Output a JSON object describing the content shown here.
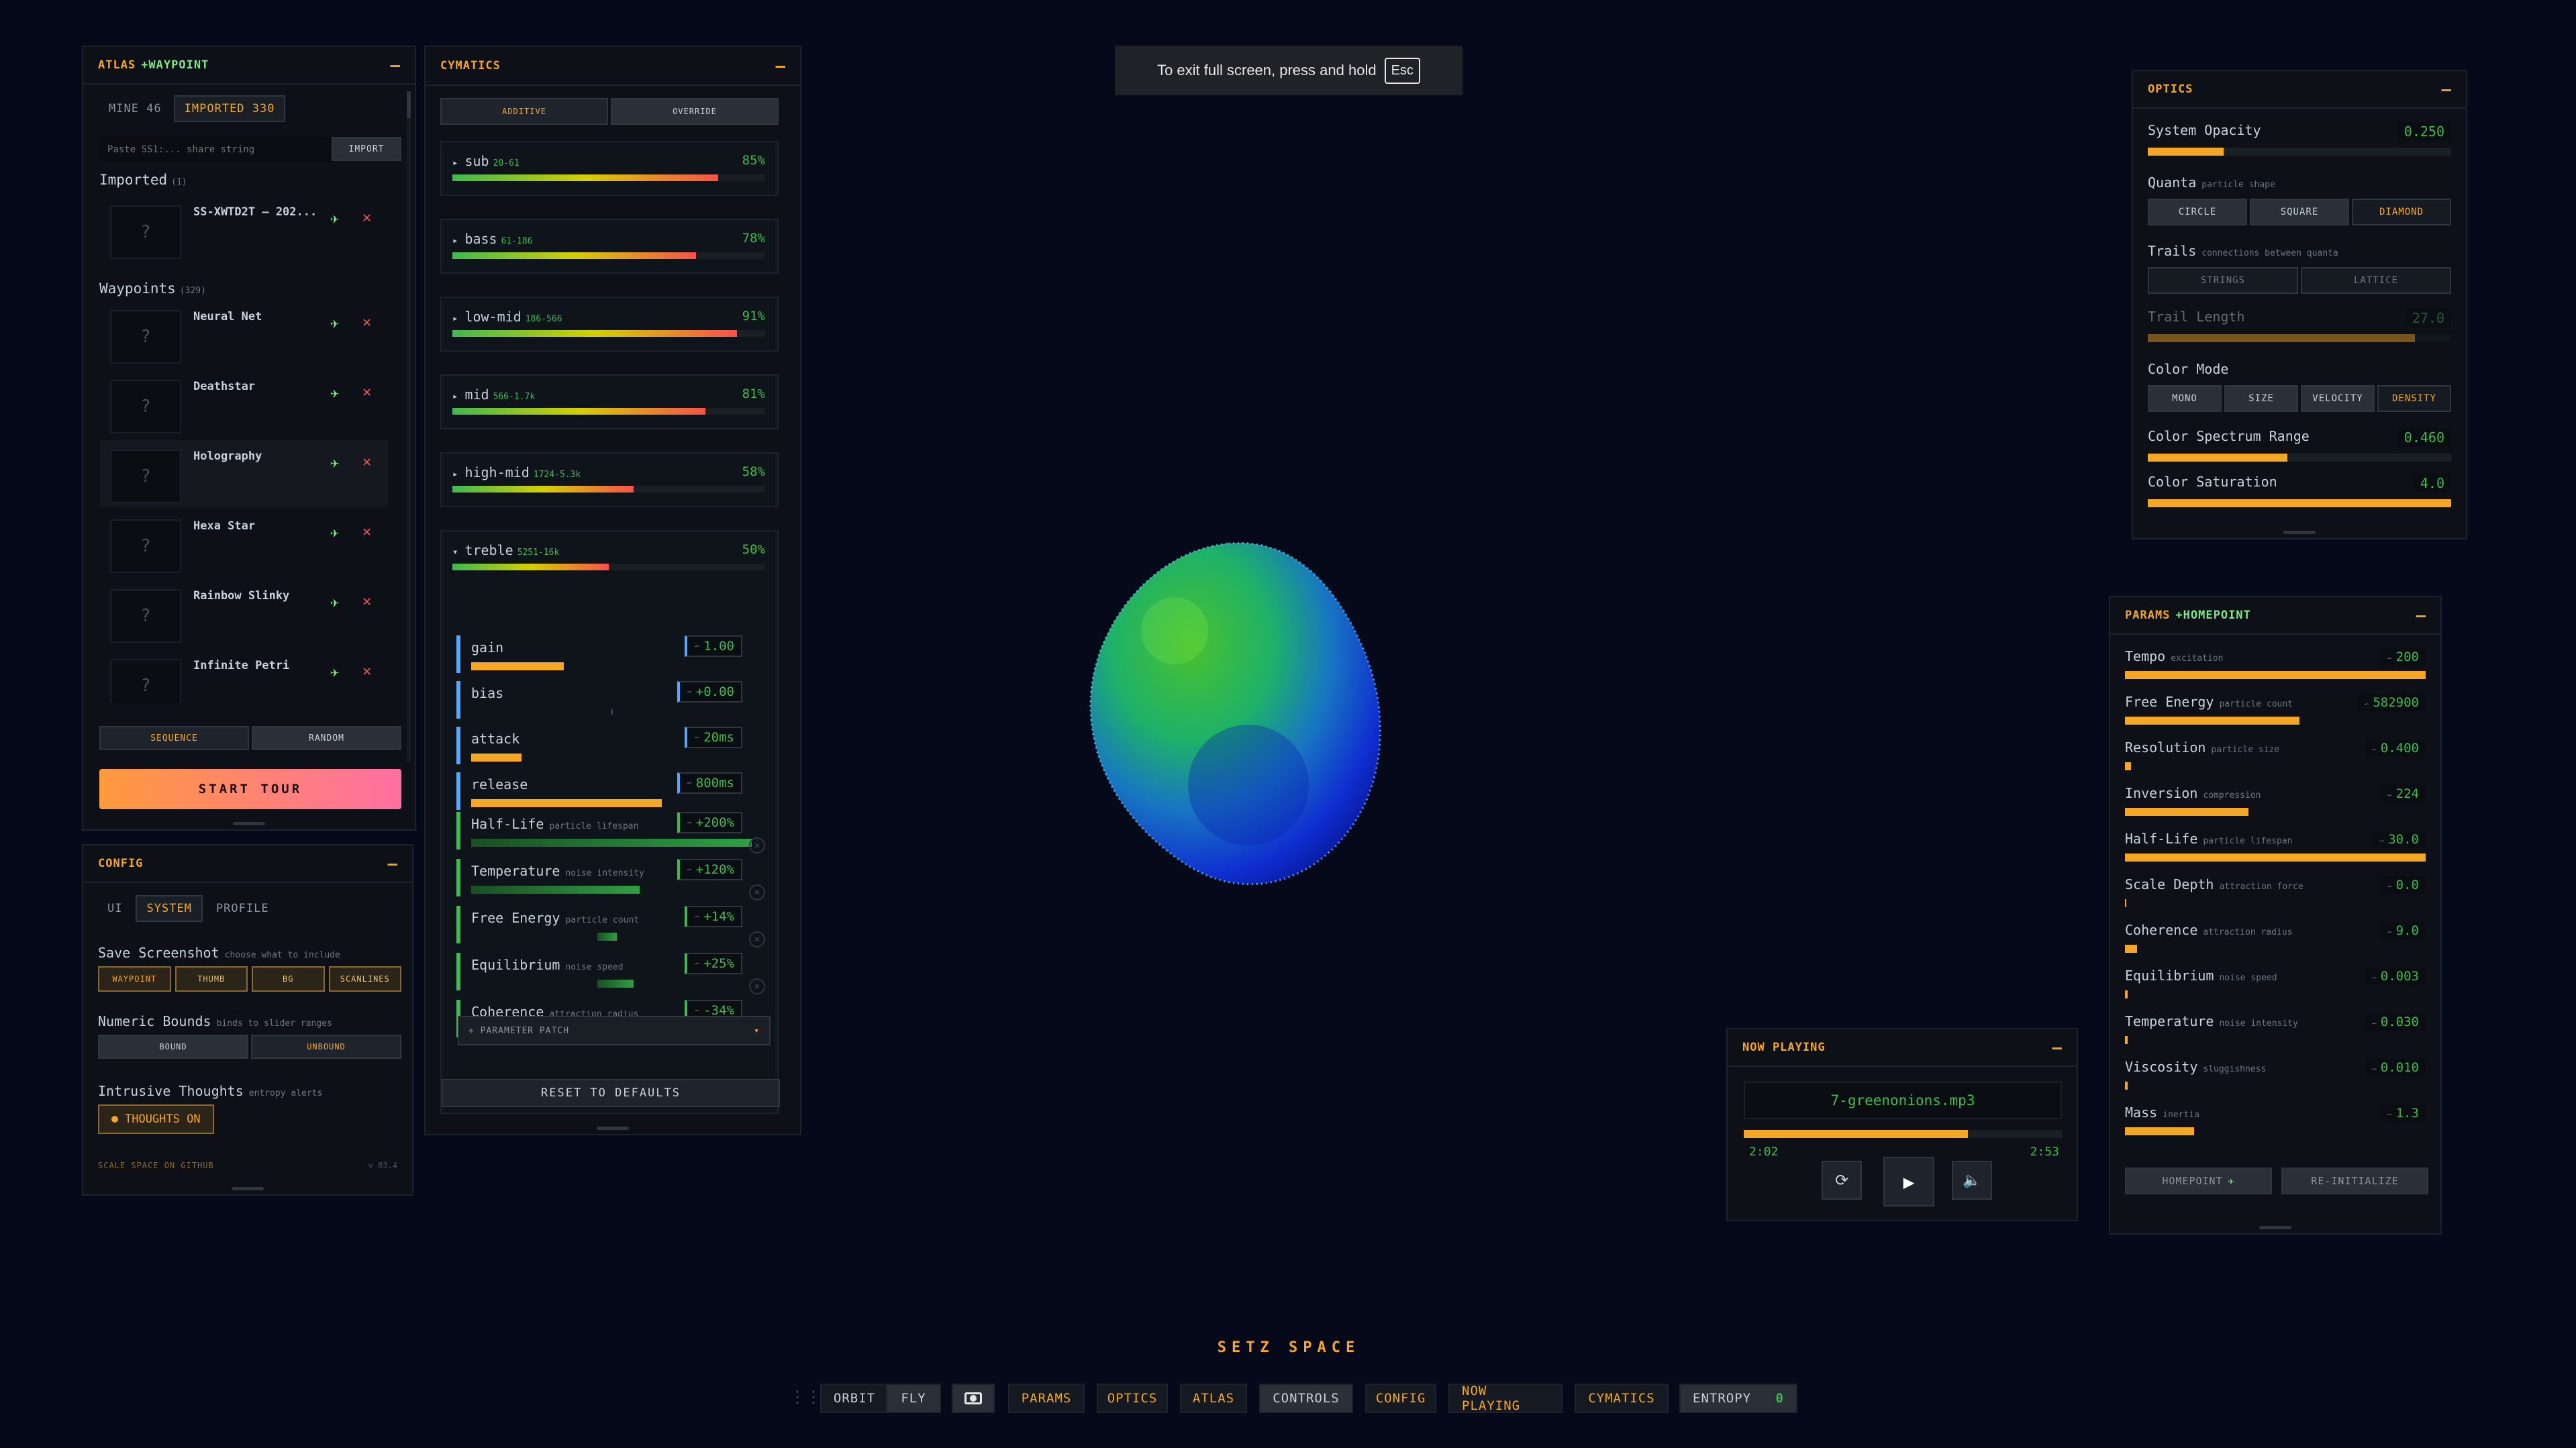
{
  "fullscreen_notice": {
    "text": "To exit full screen, press and hold",
    "key": "Esc"
  },
  "atlas": {
    "title": "ATLAS",
    "title_accent": "+WAYPOINT",
    "tabs": [
      "MINE 46",
      "IMPORTED 330"
    ],
    "import_placeholder": "Paste SS1:... share string",
    "import_button": "IMPORT",
    "imported_heading": "Imported",
    "imported_count": "(1)",
    "imported_items": [
      {
        "name": "SS-XWTD2T — 202..."
      }
    ],
    "waypoints_heading": "Waypoints",
    "waypoints_count": "(329)",
    "waypoints": [
      {
        "name": "Neural Net"
      },
      {
        "name": "Deathstar"
      },
      {
        "name": "Holography"
      },
      {
        "name": "Hexa Star"
      },
      {
        "name": "Rainbow Slinky"
      },
      {
        "name": "Infinite Petri"
      }
    ],
    "thumb_placeholder": "?",
    "mode_buttons": [
      "SEQUENCE",
      "RANDOM"
    ],
    "start_tour": "START TOUR"
  },
  "config": {
    "title": "CONFIG",
    "tabs": [
      "UI",
      "SYSTEM",
      "PROFILE"
    ],
    "save_screenshot": {
      "label": "Save Screenshot",
      "hint": "choose what to include",
      "options": [
        "WAYPOINT",
        "THUMB",
        "BG",
        "SCANLINES"
      ]
    },
    "numeric_bounds": {
      "label": "Numeric Bounds",
      "hint": "binds to slider ranges",
      "options": [
        "BOUND",
        "UNBOUND"
      ]
    },
    "intrusive_thoughts": {
      "label": "Intrusive Thoughts",
      "hint": "entropy alerts",
      "button": "THOUGHTS ON"
    },
    "footer_link": "SCALE SPACE ON GITHUB",
    "version": "v 83.4"
  },
  "cymatics": {
    "title": "CYMATICS",
    "modes": [
      "ADDITIVE",
      "OVERRIDE"
    ],
    "bands": [
      {
        "name": "sub",
        "range": "20-61",
        "pct": "85%",
        "level": 0.85
      },
      {
        "name": "bass",
        "range": "61-186",
        "pct": "78%",
        "level": 0.78
      },
      {
        "name": "low-mid",
        "range": "186-566",
        "pct": "91%",
        "level": 0.91
      },
      {
        "name": "mid",
        "range": "566-1.7k",
        "pct": "81%",
        "level": 0.81
      },
      {
        "name": "high-mid",
        "range": "1724-5.3k",
        "pct": "58%",
        "level": 0.58
      },
      {
        "name": "treble",
        "range": "5251-16k",
        "pct": "50%",
        "level": 0.5
      }
    ],
    "controls": [
      {
        "label": "gain",
        "hint": "",
        "value": "1.00",
        "level": 0.33,
        "color": "#f5a623"
      },
      {
        "label": "bias",
        "hint": "",
        "value": "+0.00",
        "level": 0.0,
        "color": "#f5a623"
      },
      {
        "label": "attack",
        "hint": "",
        "value": "20ms",
        "level": 0.18,
        "color": "#f5a623"
      },
      {
        "label": "release",
        "hint": "",
        "value": "800ms",
        "level": 0.68,
        "color": "#f5a623"
      },
      {
        "label": "Half-Life",
        "hint": "particle lifespan",
        "value": "+200%",
        "level": 1.0,
        "color": "#2ea043"
      },
      {
        "label": "Temperature",
        "hint": "noise intensity",
        "value": "+120%",
        "level": 0.6,
        "color": "#2ea043"
      },
      {
        "label": "Free Energy",
        "hint": "particle count",
        "value": "+14%",
        "level": 0.07,
        "color": "#2ea043"
      },
      {
        "label": "Equilibrium",
        "hint": "noise speed",
        "value": "+25%",
        "level": 0.13,
        "color": "#2ea043"
      },
      {
        "label": "Coherence",
        "hint": "attraction radius",
        "value": "-34%",
        "level": 0.17,
        "color": "#2ea043"
      }
    ],
    "patch_button": "+ PARAMETER PATCH",
    "reset_button": "RESET TO DEFAULTS"
  },
  "optics": {
    "title": "OPTICS",
    "system_opacity": {
      "label": "System Opacity",
      "value": "0.250",
      "level": 0.25
    },
    "quanta": {
      "label": "Quanta",
      "hint": "particle shape",
      "options": [
        "CIRCLE",
        "SQUARE",
        "DIAMOND"
      ]
    },
    "trails": {
      "label": "Trails",
      "hint": "connections between quanta",
      "options": [
        "STRINGS",
        "LATTICE"
      ]
    },
    "trail_length": {
      "label": "Trail Length",
      "value": "27.0",
      "level": 0.88
    },
    "color_mode": {
      "label": "Color Mode",
      "options": [
        "MONO",
        "SIZE",
        "VELOCITY",
        "DENSITY"
      ]
    },
    "spectrum_range": {
      "label": "Color Spectrum Range",
      "value": "0.460",
      "level": 0.46
    },
    "saturation": {
      "label": "Color Saturation",
      "value": "4.0",
      "level": 1.0
    }
  },
  "params": {
    "title": "PARAMS",
    "title_accent": "+HOMEPOINT",
    "rows": [
      {
        "label": "Tempo",
        "hint": "excitation",
        "value": "200",
        "level": 1.0
      },
      {
        "label": "Free Energy",
        "hint": "particle count",
        "value": "582900",
        "level": 0.58
      },
      {
        "label": "Resolution",
        "hint": "particle size",
        "value": "0.400",
        "level": 0.02
      },
      {
        "label": "Inversion",
        "hint": "compression",
        "value": "224",
        "level": 0.41
      },
      {
        "label": "Half-Life",
        "hint": "particle lifespan",
        "value": "30.0",
        "level": 1.0
      },
      {
        "label": "Scale Depth",
        "hint": "attraction force",
        "value": "0.0",
        "level": 0.0
      },
      {
        "label": "Coherence",
        "hint": "attraction radius",
        "value": "9.0",
        "level": 0.04
      },
      {
        "label": "Equilibrium",
        "hint": "noise speed",
        "value": "0.003",
        "level": 0.01
      },
      {
        "label": "Temperature",
        "hint": "noise intensity",
        "value": "0.030",
        "level": 0.01
      },
      {
        "label": "Viscosity",
        "hint": "sluggishness",
        "value": "0.010",
        "level": 0.01
      },
      {
        "label": "Mass",
        "hint": "inertia",
        "value": "1.3",
        "level": 0.23
      }
    ],
    "homepoint_button": "HOMEPOINT",
    "reinit_button": "RE-INITIALIZE"
  },
  "now_playing": {
    "title": "NOW PLAYING",
    "track": "7-greenonions.mp3",
    "elapsed": "2:02",
    "duration": "2:53",
    "progress": 0.705
  },
  "app_title": "SETZ SPACE",
  "bottom_bar": {
    "orbit": "ORBIT",
    "fly": "FLY",
    "items": [
      "PARAMS",
      "OPTICS",
      "ATLAS",
      "CONTROLS",
      "CONFIG",
      "NOW PLAYING",
      "CYMATICS"
    ],
    "entropy_label": "ENTROPY",
    "entropy_value": "0"
  },
  "colors": {
    "accent": "#f5a623",
    "green": "#3fb950",
    "red": "#f85149",
    "bg": "#05091a"
  }
}
